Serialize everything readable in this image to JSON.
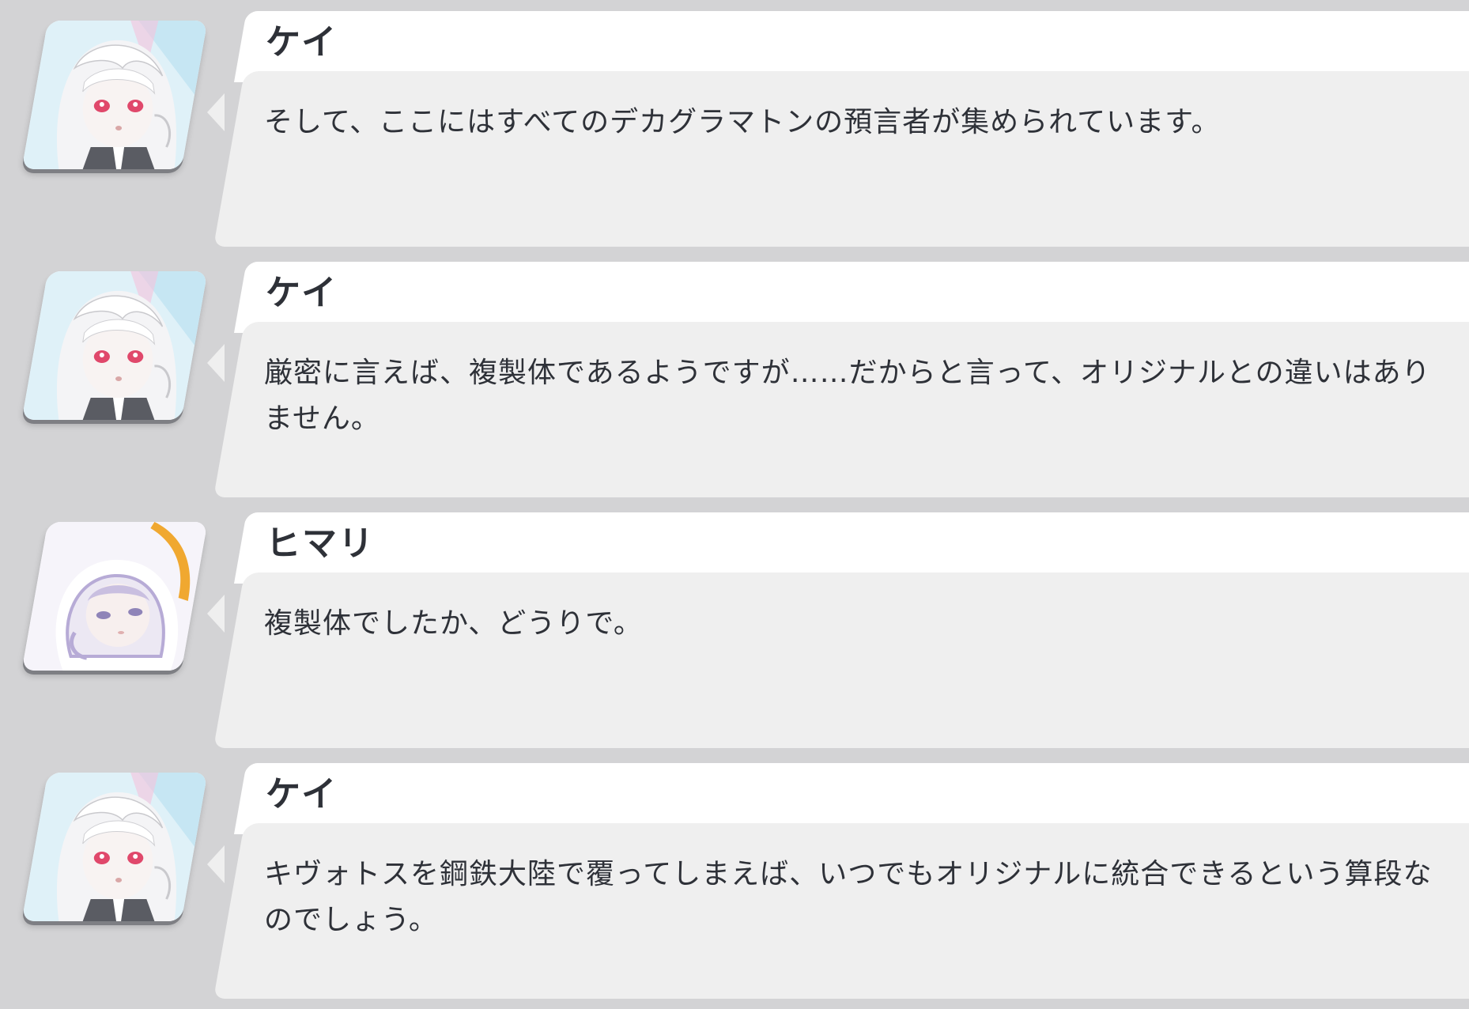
{
  "dialogue_log": [
    {
      "speaker": "ケイ",
      "portrait_icon": "kei-portrait-icon",
      "text": "そして、ここにはすべてのデカグラマトンの預言者が集められています。"
    },
    {
      "speaker": "ケイ",
      "portrait_icon": "kei-portrait-icon",
      "text": "厳密に言えば、複製体であるようですが……だからと言って、オリジナルとの違いはありません。"
    },
    {
      "speaker": "ヒマリ",
      "portrait_icon": "himari-portrait-icon",
      "text": "複製体でしたか、どうりで。"
    },
    {
      "speaker": "ケイ",
      "portrait_icon": "kei-portrait-icon",
      "text": "キヴォトスを鋼鉄大陸で覆ってしまえば、いつでもオリジナルに統合できるという算段なのでしょう。"
    }
  ],
  "colors": {
    "background": "#d3d3d5",
    "name_plate": "#ffffff",
    "dialogue_box": "#efefef",
    "text": "#2e3138",
    "kei_eye": "#e0486b",
    "himari_halo": "#f0a830"
  }
}
